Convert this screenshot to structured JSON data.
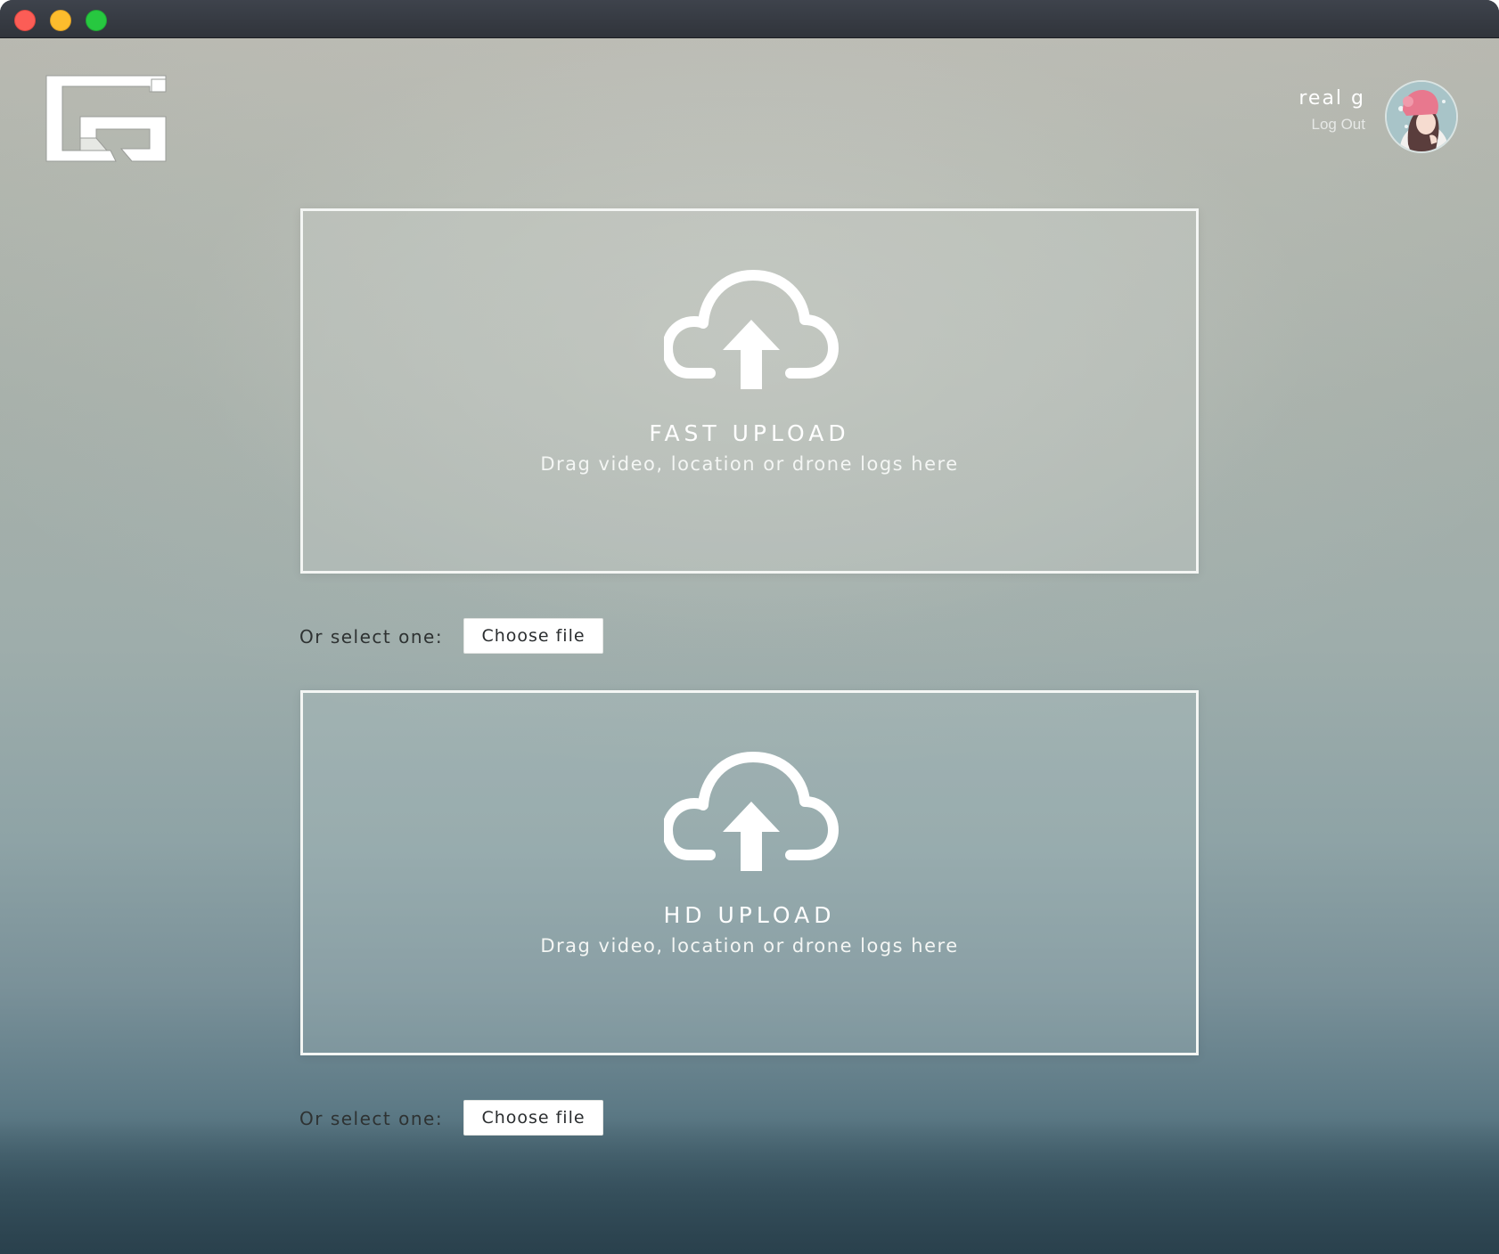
{
  "window": {
    "traffic_lights": [
      "close",
      "minimize",
      "maximize"
    ]
  },
  "header": {
    "logo_icon": "app-logo-icon",
    "user": {
      "name": "real g",
      "logout_label": "Log Out",
      "avatar_icon": "user-avatar"
    }
  },
  "uploads": [
    {
      "title": "FAST UPLOAD",
      "subtitle": "Drag video, location or drone logs here",
      "icon": "cloud-upload-icon",
      "select_label": "Or select one:",
      "button_label": "Choose file"
    },
    {
      "title": "HD UPLOAD",
      "subtitle": "Drag video, location or drone logs here",
      "icon": "cloud-upload-icon",
      "select_label": "Or select one:",
      "button_label": "Choose file"
    }
  ],
  "colors": {
    "accent_white": "#ffffff",
    "background_top": "#b8b8b0",
    "background_bottom": "#344f5b",
    "label_text": "#2e3232"
  }
}
